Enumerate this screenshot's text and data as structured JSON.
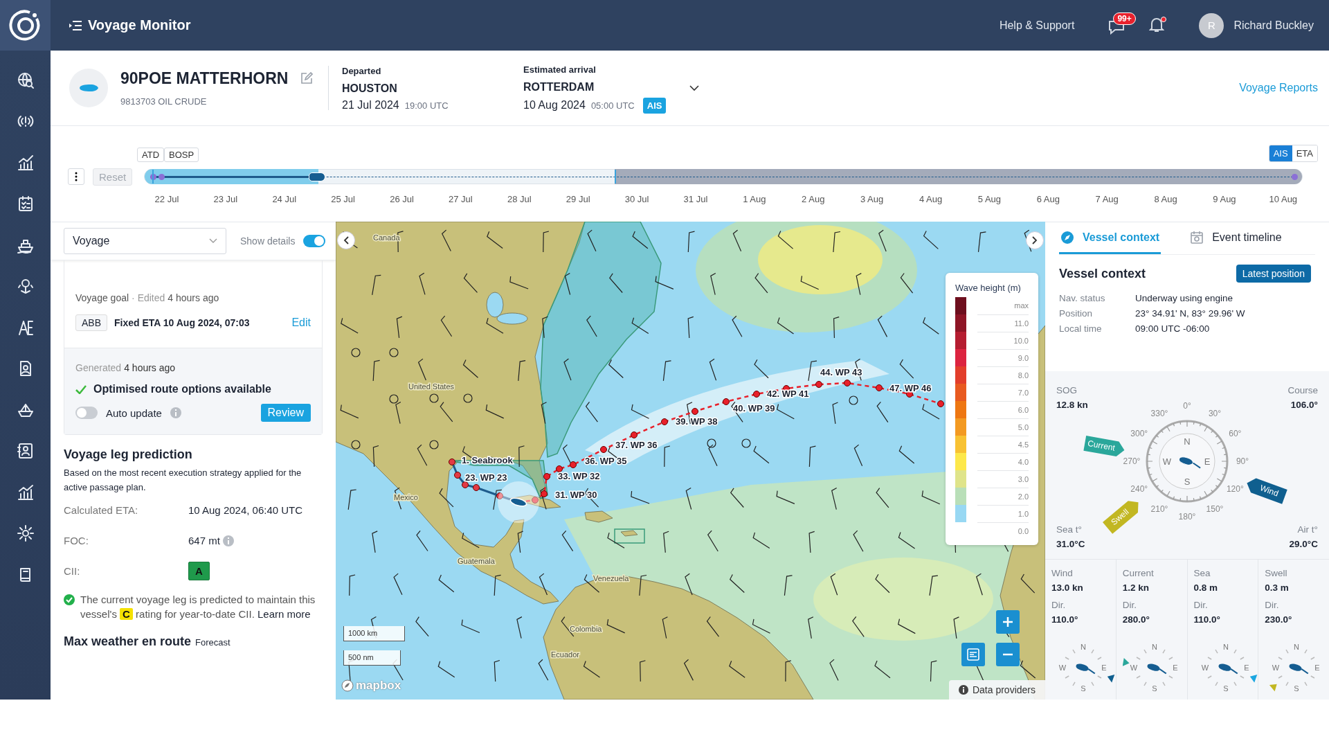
{
  "top_bar": {
    "title": "Voyage Monitor",
    "help": "Help & Support",
    "messages_badge": "99+",
    "notifications_unread": true,
    "user": {
      "initial": "R",
      "name": "Richard Buckley"
    }
  },
  "sidebar": {
    "items": [
      {
        "kind": "globe"
      },
      {
        "kind": "signal"
      },
      {
        "kind": "chart"
      },
      {
        "kind": "checklist"
      },
      {
        "kind": "ship"
      },
      {
        "kind": "pin"
      },
      {
        "kind": "letters"
      },
      {
        "kind": "report"
      },
      {
        "kind": "vessel"
      },
      {
        "kind": "contacts"
      },
      {
        "kind": "analytics"
      },
      {
        "kind": "settings"
      },
      {
        "kind": "book"
      }
    ]
  },
  "vessel": {
    "name": "90POE MATTERHORN",
    "subtitle": "9813703 OIL CRUDE",
    "departed": {
      "label": "Departed",
      "port": "HOUSTON",
      "date": "21 Jul 2024",
      "time": "19:00 UTC"
    },
    "arrival": {
      "label": "Estimated arrival",
      "port": "ROTTERDAM",
      "date": "10 Aug 2024",
      "time": "05:00 UTC",
      "badge": "AIS"
    },
    "reports_link": "Voyage Reports"
  },
  "timeline": {
    "reset": "Reset",
    "markers": [
      "ATD",
      "BOSP"
    ],
    "level": 0.15,
    "modes": [
      {
        "label": "AIS",
        "selected": true
      },
      {
        "label": "ETA",
        "selected": false
      }
    ],
    "ticks": [
      "22 Jul",
      "23 Jul",
      "24 Jul",
      "25 Jul",
      "26 Jul",
      "27 Jul",
      "28 Jul",
      "29 Jul",
      "30 Jul",
      "31 Jul",
      "1 Aug",
      "2 Aug",
      "3 Aug",
      "4 Aug",
      "5 Aug",
      "6 Aug",
      "7 Aug",
      "8 Aug",
      "9 Aug",
      "10 Aug"
    ]
  },
  "left_panel": {
    "dropdown": "Voyage",
    "show_details": {
      "label": "Show details",
      "on": true
    },
    "goal": {
      "label": "Voyage goal",
      "edited": "· Edited",
      "edited_time": "4 hours ago",
      "tag": "ABB",
      "text": "Fixed ETA 10 Aug 2024, 07:03",
      "edit": "Edit"
    },
    "optimisation": {
      "generated": "Generated",
      "generated_time": "4 hours ago",
      "status": "Optimised route options available",
      "auto_update": {
        "label": "Auto update",
        "on": false
      },
      "review": "Review"
    },
    "prediction": {
      "title": "Voyage leg prediction",
      "description": "Based on the most recent execution strategy applied for the active passage plan.",
      "rows": [
        {
          "kind": "text",
          "label": "Calculated ETA:",
          "value": "10 Aug 2024, 06:40 UTC"
        },
        {
          "kind": "info",
          "label": "FOC:",
          "value": "647 mt"
        },
        {
          "kind": "rating",
          "label": "CII:",
          "value": "A"
        }
      ],
      "note": {
        "before": "The current voyage leg is predicted to maintain this vessel's",
        "rating": "C",
        "after": "rating for year-to-date CII.",
        "link": "Learn more"
      }
    },
    "weather": {
      "title": "Max weather en route",
      "subtitle": "Forecast"
    }
  },
  "map": {
    "places": [
      "Canada",
      "United States",
      "Mexico",
      "Guatemala",
      "Venezuela",
      "Colombia",
      "Ecuador"
    ],
    "waypoints": [
      "1. Seabrook",
      "23. WP 23",
      "31. WP 30",
      "33. WP 32",
      "36. WP 35",
      "37. WP 36",
      "39. WP 38",
      "40. WP 39",
      "42. WP 41",
      "44. WP 43",
      "47. WP 46"
    ],
    "legend": {
      "title": "Wave height (m)",
      "levels": [
        {
          "label": "max",
          "color": "#6e0f1e"
        },
        {
          "label": "11.0",
          "color": "#8e1526"
        },
        {
          "label": "10.0",
          "color": "#b51d31"
        },
        {
          "label": "9.0",
          "color": "#dc2440"
        },
        {
          "label": "8.0",
          "color": "#e23e2b"
        },
        {
          "label": "7.0",
          "color": "#e85a20"
        },
        {
          "label": "6.0",
          "color": "#ee7712"
        },
        {
          "label": "5.0",
          "color": "#f39a22"
        },
        {
          "label": "4.5",
          "color": "#f8c233"
        },
        {
          "label": "4.0",
          "color": "#fde84a"
        },
        {
          "label": "3.0",
          "color": "#dfe48a"
        },
        {
          "label": "2.0",
          "color": "#b9dfb8"
        },
        {
          "label": "1.0",
          "color": "#98d8f3"
        },
        {
          "label": "0.0"
        }
      ]
    },
    "scale": [
      "1000 km",
      "500 nm"
    ],
    "attribution": "mapbox",
    "data_providers": "Data providers"
  },
  "right_panel": {
    "tabs": [
      {
        "kind": "compass",
        "label": "Vessel context",
        "selected": true
      },
      {
        "kind": "calendar",
        "label": "Event timeline",
        "selected": false
      }
    ],
    "title": "Vessel context",
    "button": "Latest position",
    "info": [
      {
        "label": "Nav. status",
        "value": "Underway using engine"
      },
      {
        "label": "Position",
        "value": "23° 34.91' N, 83° 29.96' W"
      },
      {
        "label": "Local time",
        "value": "09:00 UTC -06:00"
      }
    ],
    "corners": [
      {
        "label": "SOG",
        "value": "12.8 kn"
      },
      {
        "label": "Course",
        "value": "106.0°"
      },
      {
        "label": "Sea t°",
        "value": "31.0°C"
      },
      {
        "label": "Air t°",
        "value": "29.0°C"
      }
    ],
    "compass": {
      "degree_labels": [
        "0°",
        "30°",
        "60°",
        "90°",
        "120°",
        "150°",
        "180°",
        "210°",
        "240°",
        "270°",
        "300°",
        "330°"
      ],
      "cardinals": [
        "N",
        "E",
        "S",
        "W"
      ],
      "arrows": [
        {
          "kind": "current",
          "label": "Current",
          "color": "#2aa79b"
        },
        {
          "kind": "wind",
          "label": "Wind",
          "color": "#0f5f8f"
        },
        {
          "kind": "swell",
          "label": "Swell",
          "color": "#c2b722"
        }
      ]
    },
    "columns": [
      {
        "kind": "wind",
        "title": "Wind",
        "value": "13.0 kn",
        "dir_label": "Dir.",
        "dir": "110.0°",
        "color": "#0f5f8f",
        "cardinals": [
          "N",
          "E",
          "S",
          "W"
        ]
      },
      {
        "kind": "current",
        "title": "Current",
        "value": "1.2 kn",
        "dir_label": "Dir.",
        "dir": "280.0°",
        "color": "#2aa79b",
        "cardinals": [
          "N",
          "E",
          "S",
          "W"
        ]
      },
      {
        "kind": "sea",
        "title": "Sea",
        "value": "0.8 m",
        "dir_label": "Dir.",
        "dir": "110.0°",
        "color": "#1ba6e0",
        "cardinals": [
          "N",
          "E",
          "S",
          "W"
        ]
      },
      {
        "kind": "swell",
        "title": "Swell",
        "value": "0.3 m",
        "dir_label": "Dir.",
        "dir": "230.0°",
        "color": "#c2b722",
        "cardinals": [
          "N",
          "E",
          "S",
          "W"
        ]
      }
    ]
  }
}
